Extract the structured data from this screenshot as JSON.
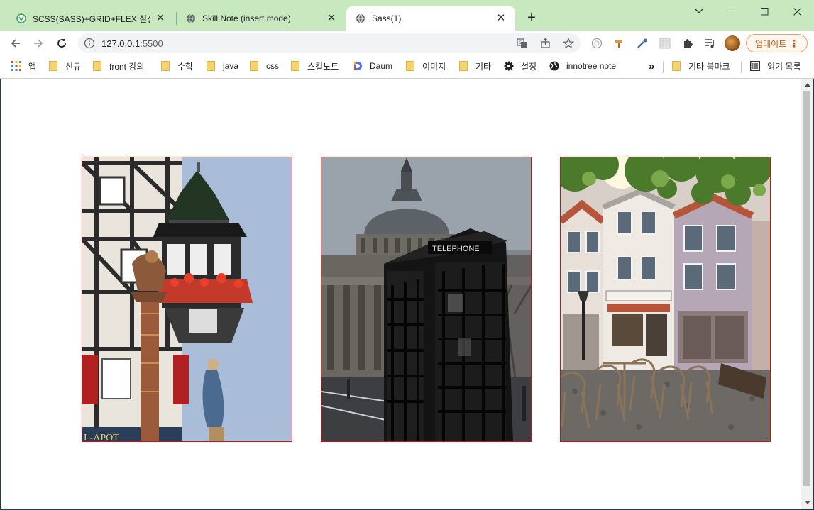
{
  "tabs": [
    {
      "title": "SCSS(SASS)+GRID+FLEX 실전 프",
      "icon": "notion-style-icon",
      "active": false
    },
    {
      "title": "Skill Note (insert mode)",
      "icon": "globe-icon",
      "active": false
    },
    {
      "title": "Sass(1)",
      "icon": "globe-icon",
      "active": true
    }
  ],
  "address": {
    "host": "127.0.0.1",
    "port": ":5500"
  },
  "update_label": "업데이트",
  "bookmarks": [
    {
      "label": "앱",
      "icon": "apps-grid-icon"
    },
    {
      "label": "신규",
      "icon": "folder-icon"
    },
    {
      "label": "front 강의",
      "icon": "folder-icon"
    },
    {
      "label": "수학",
      "icon": "folder-icon"
    },
    {
      "label": "java",
      "icon": "folder-icon"
    },
    {
      "label": "css",
      "icon": "folder-icon"
    },
    {
      "label": "스킬노트",
      "icon": "folder-icon"
    },
    {
      "label": "Daum",
      "icon": "daum-logo-icon"
    },
    {
      "label": "이미지",
      "icon": "folder-icon"
    },
    {
      "label": "기타",
      "icon": "folder-icon"
    },
    {
      "label": "설정",
      "icon": "gear-icon"
    },
    {
      "label": "innotree note",
      "icon": "globe-icon"
    }
  ],
  "bookmarks_overflow": "»",
  "other_bookmarks": "기타 북마크",
  "reading_list": "읽기 목록",
  "content": {
    "images": [
      {
        "subject": "half-timbered house with turret and flower boxes"
      },
      {
        "subject": "black telephone box in front of domed cathedral"
      },
      {
        "subject": "cobblestone square with cafe chairs and pastel houses"
      }
    ],
    "telephone_sign": "TELEPHONE",
    "shop_sign": "L-APOT"
  },
  "colors": {
    "tabstrip": "#c8e8c0",
    "card_border": "#d01010",
    "update_accent": "#c05a10"
  }
}
